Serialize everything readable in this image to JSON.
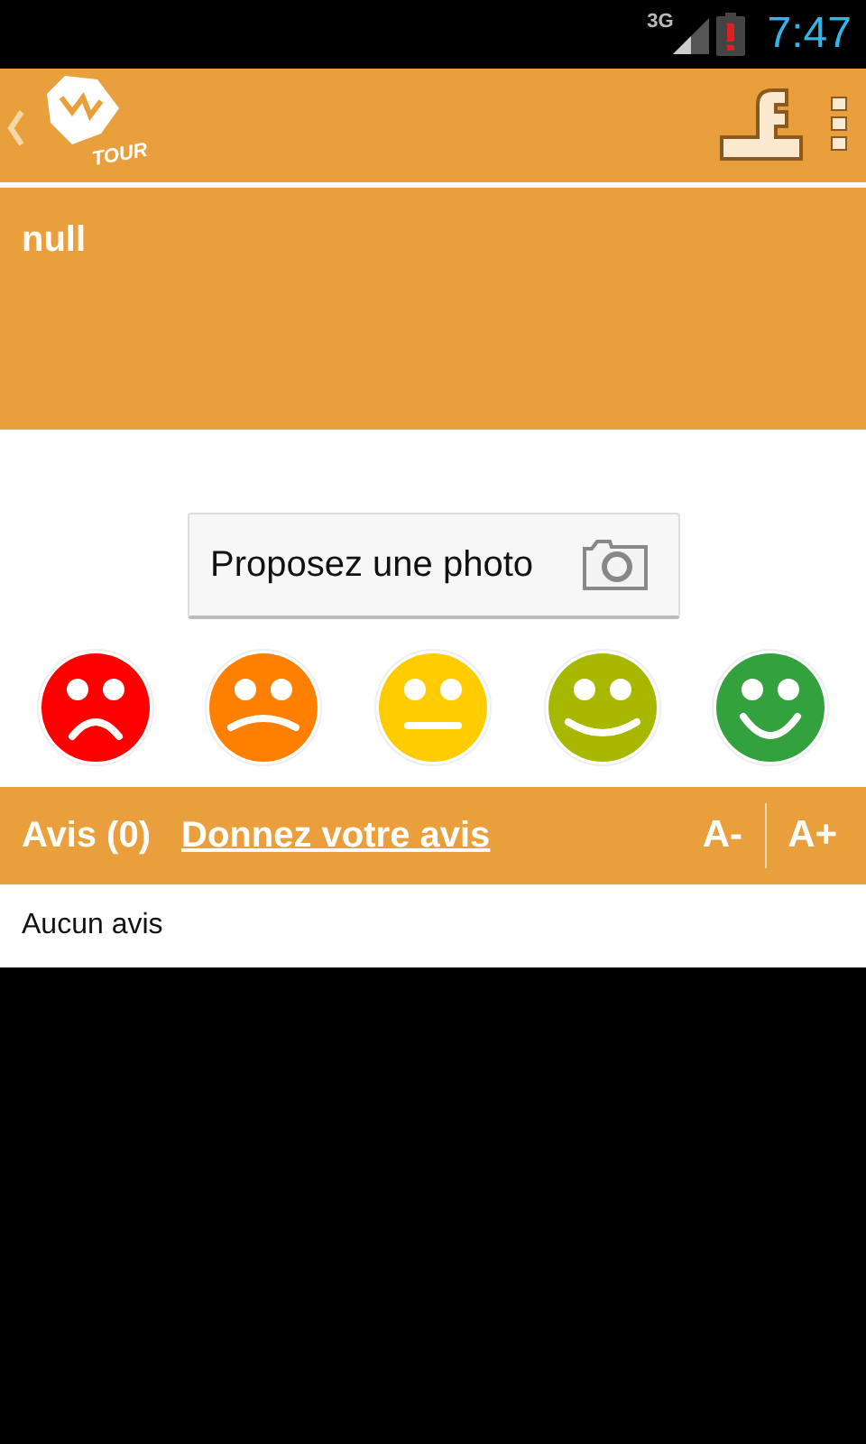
{
  "status_bar": {
    "network": "3G",
    "time": "7:47"
  },
  "action_bar": {
    "logo_text": "TOUR"
  },
  "header": {
    "title": "null"
  },
  "photo_button": {
    "label": "Proposez une photo"
  },
  "ratings": [
    {
      "kind": "sad",
      "color": "#ff0000"
    },
    {
      "kind": "unhappy",
      "color": "#ff8000"
    },
    {
      "kind": "neutral",
      "color": "#ffcc00"
    },
    {
      "kind": "content",
      "color": "#a8b800"
    },
    {
      "kind": "happy",
      "color": "#33a23c"
    }
  ],
  "reviews_bar": {
    "count_label": "Avis (0)",
    "link": "Donnez votre avis",
    "smaller": "A-",
    "larger": "A+"
  },
  "reviews": {
    "empty_text": "Aucun avis"
  }
}
